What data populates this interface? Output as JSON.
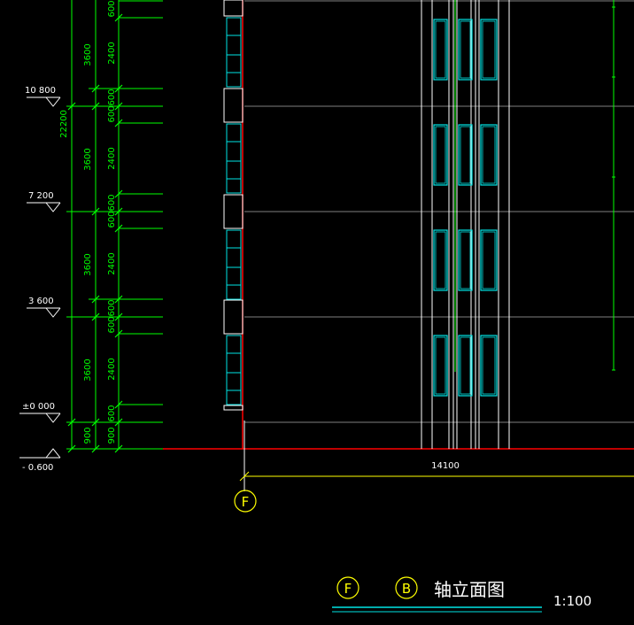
{
  "elevation_labels": [
    "10 800",
    "7 200",
    "3 600",
    "±0 000",
    "- 0.600"
  ],
  "dimensions": {
    "total": "22200",
    "floor": "3600",
    "sill": "600",
    "window": "2400",
    "base": "900",
    "horizontal_total": "14100"
  },
  "grid_axis_label": "F",
  "title": {
    "axis_start": "F",
    "axis_end": "B",
    "text": "轴立面图",
    "scale": "1:100"
  },
  "colors": {
    "background": "#000000",
    "dimension_line": "#00ff00",
    "elevation_text": "#ffffff",
    "grid_line": "#808080",
    "window_frame": "#00e5e5",
    "outline_red": "#ff0000",
    "axis_yellow": "#ffff00"
  }
}
